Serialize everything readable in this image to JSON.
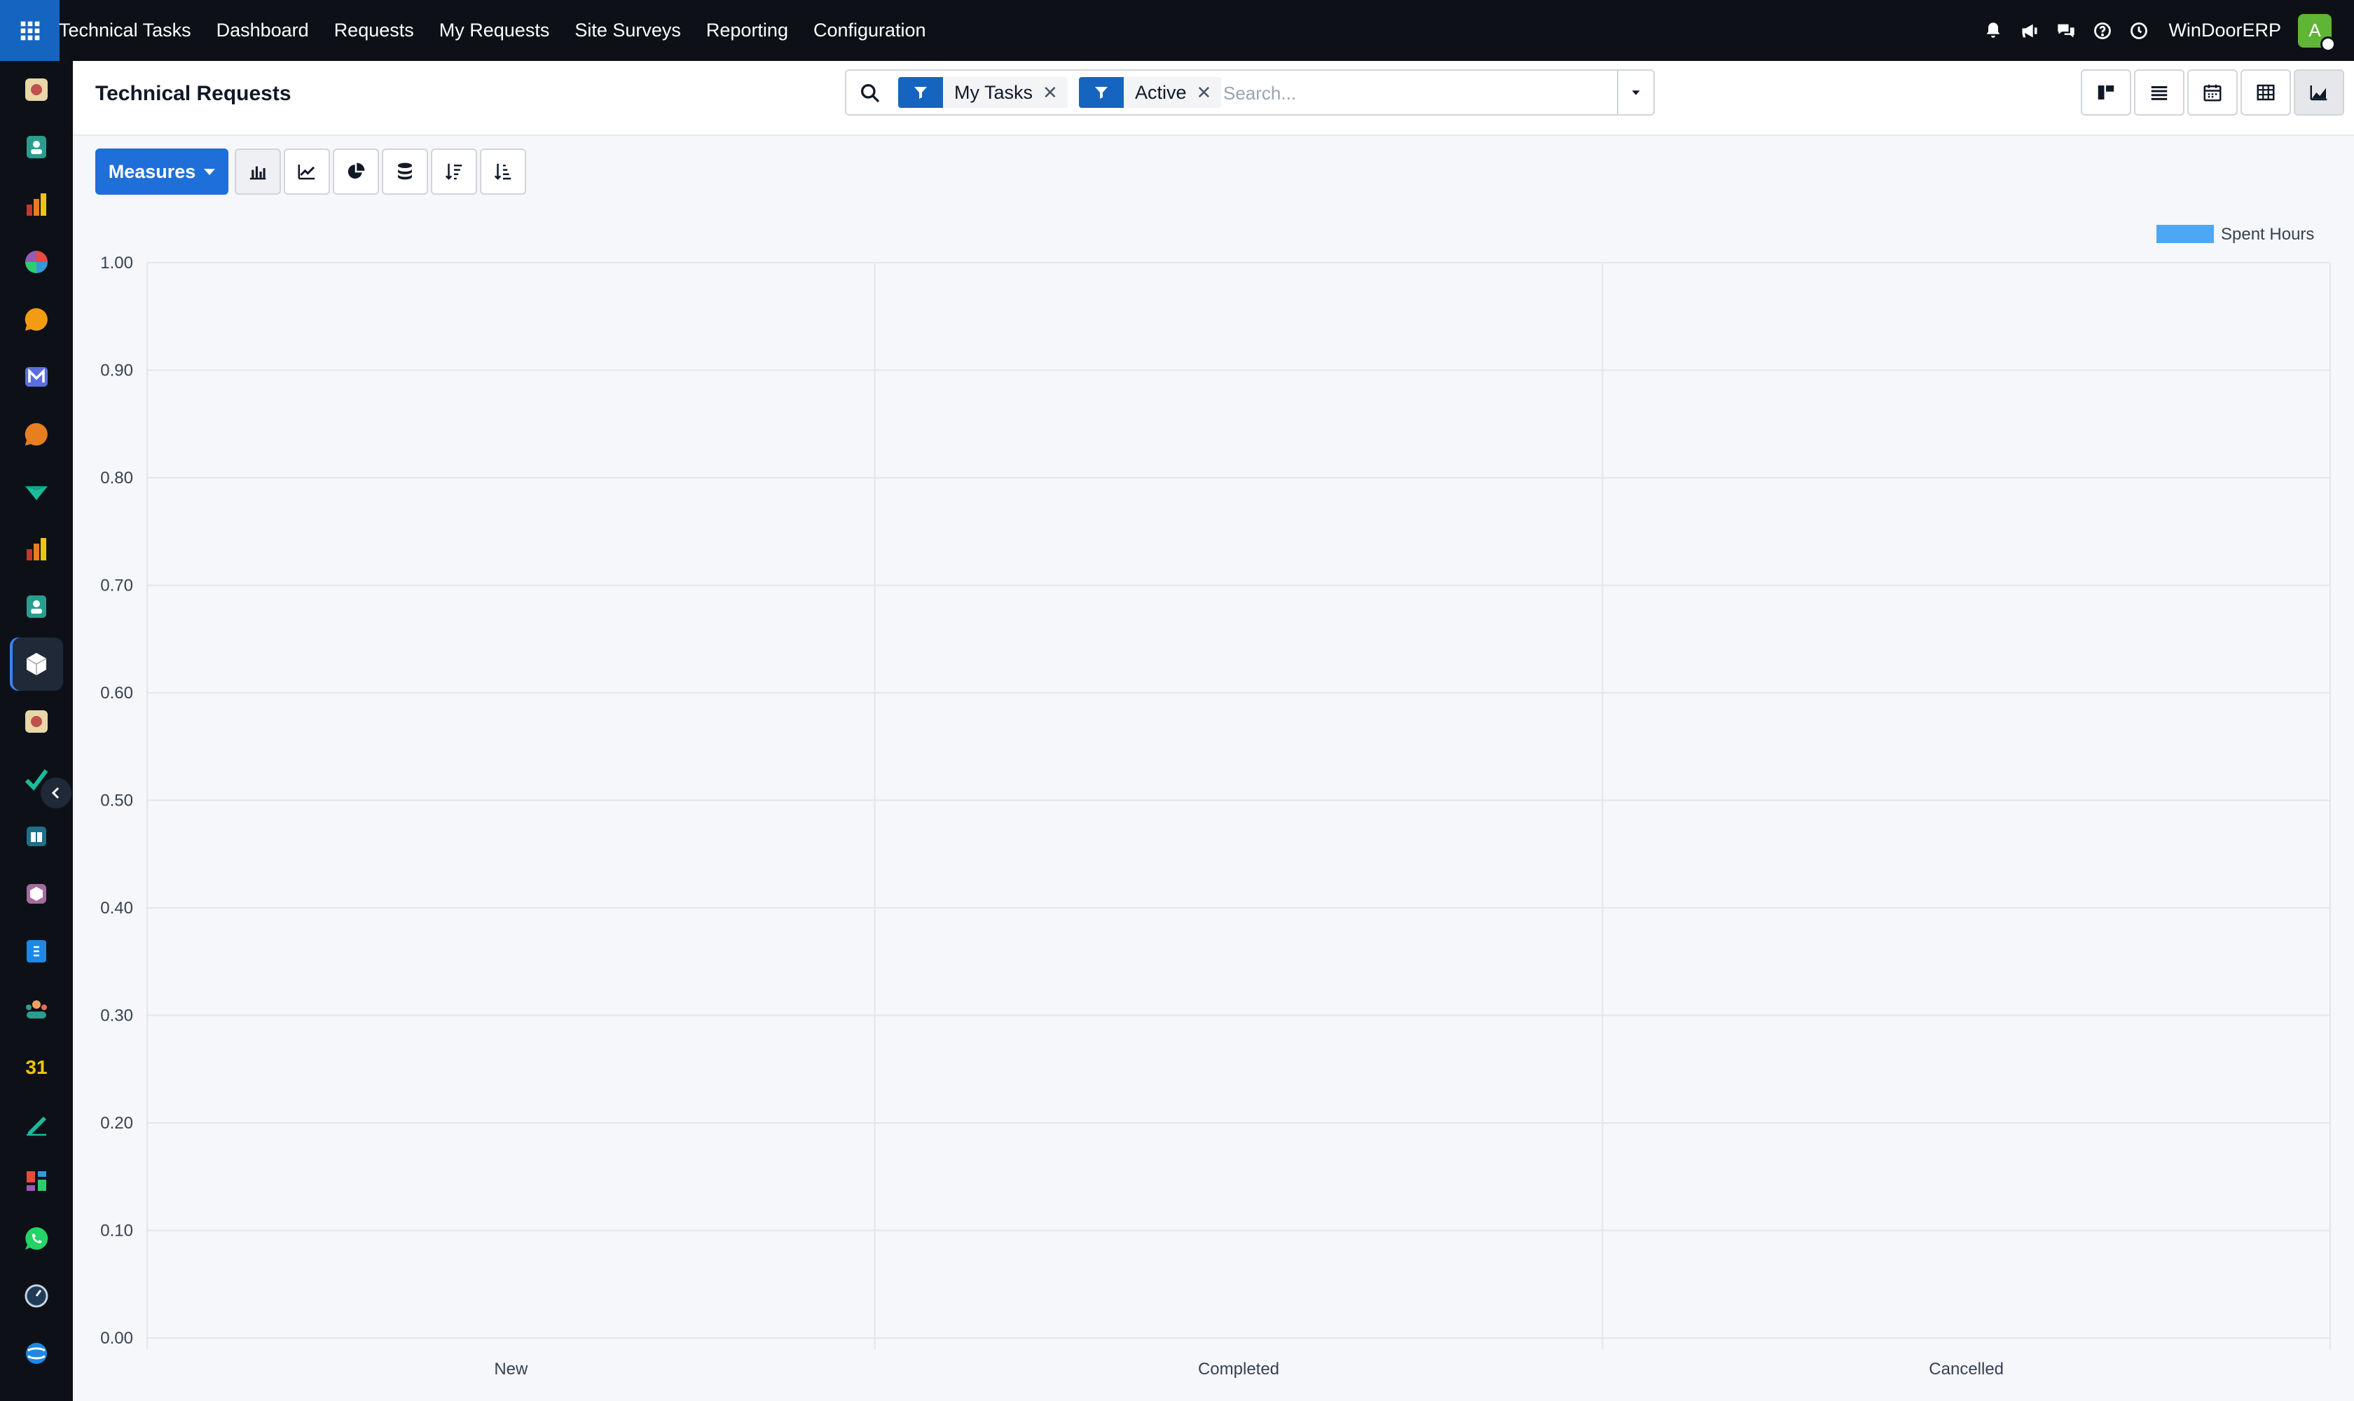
{
  "topbar": {
    "app_name": "Technical Tasks",
    "menu": [
      "Dashboard",
      "Requests",
      "My Requests",
      "Site Surveys",
      "Reporting",
      "Configuration"
    ],
    "company": "WinDoorERP",
    "avatar_letter": "A",
    "icons": [
      "bell-icon",
      "megaphone-icon",
      "chat-icon",
      "help-icon",
      "clock-icon"
    ]
  },
  "sidebar": {
    "icons": [
      "app-1-icon",
      "contacts-icon",
      "sales-icon",
      "dashboard-icon",
      "discuss-icon",
      "mail-icon",
      "livechat-icon",
      "inventory-icon",
      "reporting-icon",
      "employees-icon",
      "technical-tasks-icon",
      "app-12-icon",
      "project-icon",
      "knowledge-icon",
      "product-icon",
      "invoicing-icon",
      "team-icon",
      "calendar-icon",
      "sign-icon",
      "dashboards-icon",
      "whatsapp-icon",
      "timer-icon",
      "settings-icon"
    ],
    "active_index": 10,
    "calendar_day": "31"
  },
  "control": {
    "title": "Technical Requests",
    "facets": [
      {
        "label": "My Tasks"
      },
      {
        "label": "Active"
      }
    ],
    "search_placeholder": "Search...",
    "views": [
      "kanban-icon",
      "list-icon",
      "calendar-icon",
      "pivot-icon",
      "graph-icon"
    ],
    "active_view": 4
  },
  "toolbar": {
    "measures_label": "Measures",
    "buttons": [
      "bar-chart-icon",
      "line-chart-icon",
      "pie-chart-icon",
      "stacked-icon",
      "descending-icon",
      "ascending-icon"
    ],
    "active_button": 0
  },
  "colors": {
    "series": "#4ea7f2",
    "grid": "#e3e6ea",
    "axis_text": "#374151",
    "accent": "#1e6fd9"
  },
  "chart_data": {
    "type": "bar",
    "categories": [
      "New",
      "Completed",
      "Cancelled"
    ],
    "series": [
      {
        "name": "Spent Hours",
        "values": [
          0,
          0,
          0
        ]
      }
    ],
    "ylim": [
      0,
      1
    ],
    "yticks": [
      "0.00",
      "0.10",
      "0.20",
      "0.30",
      "0.40",
      "0.50",
      "0.60",
      "0.70",
      "0.80",
      "0.90",
      "1.00"
    ],
    "legend": "top-right",
    "grid": true
  }
}
